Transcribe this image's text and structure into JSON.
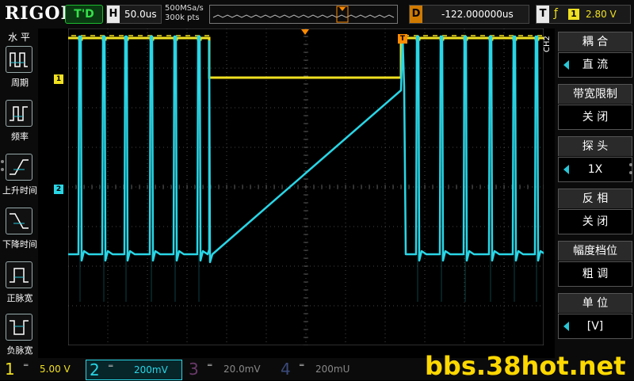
{
  "brand": "RIGOL",
  "top": {
    "run_state": "T'D",
    "timebase_key": "H",
    "timebase": "50.0us",
    "sample_rate": "500MSa/s",
    "mem_depth": "300k pts",
    "delay_key": "D",
    "delay": "-122.000000us",
    "trigger_key": "T",
    "trigger_edge": "ƒ",
    "trigger_source": "1",
    "trigger_level": "2.80 V"
  },
  "left_panel": {
    "title": "水 平",
    "items": [
      {
        "label": "周期",
        "icon": "period-icon"
      },
      {
        "label": "频率",
        "icon": "frequency-icon"
      },
      {
        "label": "上升时间",
        "icon": "rise-time-icon"
      },
      {
        "label": "下降时间",
        "icon": "fall-time-icon"
      },
      {
        "label": "正脉宽",
        "icon": "positive-width-icon"
      },
      {
        "label": "负脉宽",
        "icon": "negative-width-icon"
      }
    ]
  },
  "right_panel": {
    "channel_tag": "CH2",
    "menus": [
      {
        "title": "耦 合",
        "value": "直 流",
        "has_arrow": true
      },
      {
        "title": "带宽限制",
        "value": "关 闭",
        "has_arrow": false
      },
      {
        "title": "探 头",
        "value": "1X",
        "has_arrow": true
      },
      {
        "title": "反 相",
        "value": "关 闭",
        "has_arrow": false
      },
      {
        "title": "幅度档位",
        "value": "粗 调",
        "has_arrow": false
      },
      {
        "title": "单 位",
        "value": "[V]",
        "has_arrow": true
      }
    ]
  },
  "markers": {
    "ch1_marker": "1",
    "ch2_marker": "2",
    "trigger_marker": "T"
  },
  "channels": [
    {
      "num": "1",
      "scale": "5.00 V",
      "color": "#f0e020",
      "active": false
    },
    {
      "num": "2",
      "scale": "200mV",
      "color": "#29d6e6",
      "active": true
    },
    {
      "num": "3",
      "scale": "20.0mV",
      "color": "#c040c0",
      "active": false
    },
    {
      "num": "4",
      "scale": "200mU",
      "color": "#4a6bd6",
      "active": false
    }
  ],
  "watermark": "bbs.38hot.net",
  "colors": {
    "ch1": "#f0e020",
    "ch2": "#29d6e6",
    "trigger": "#ff8a00",
    "grid": "#5a5a5a"
  }
}
